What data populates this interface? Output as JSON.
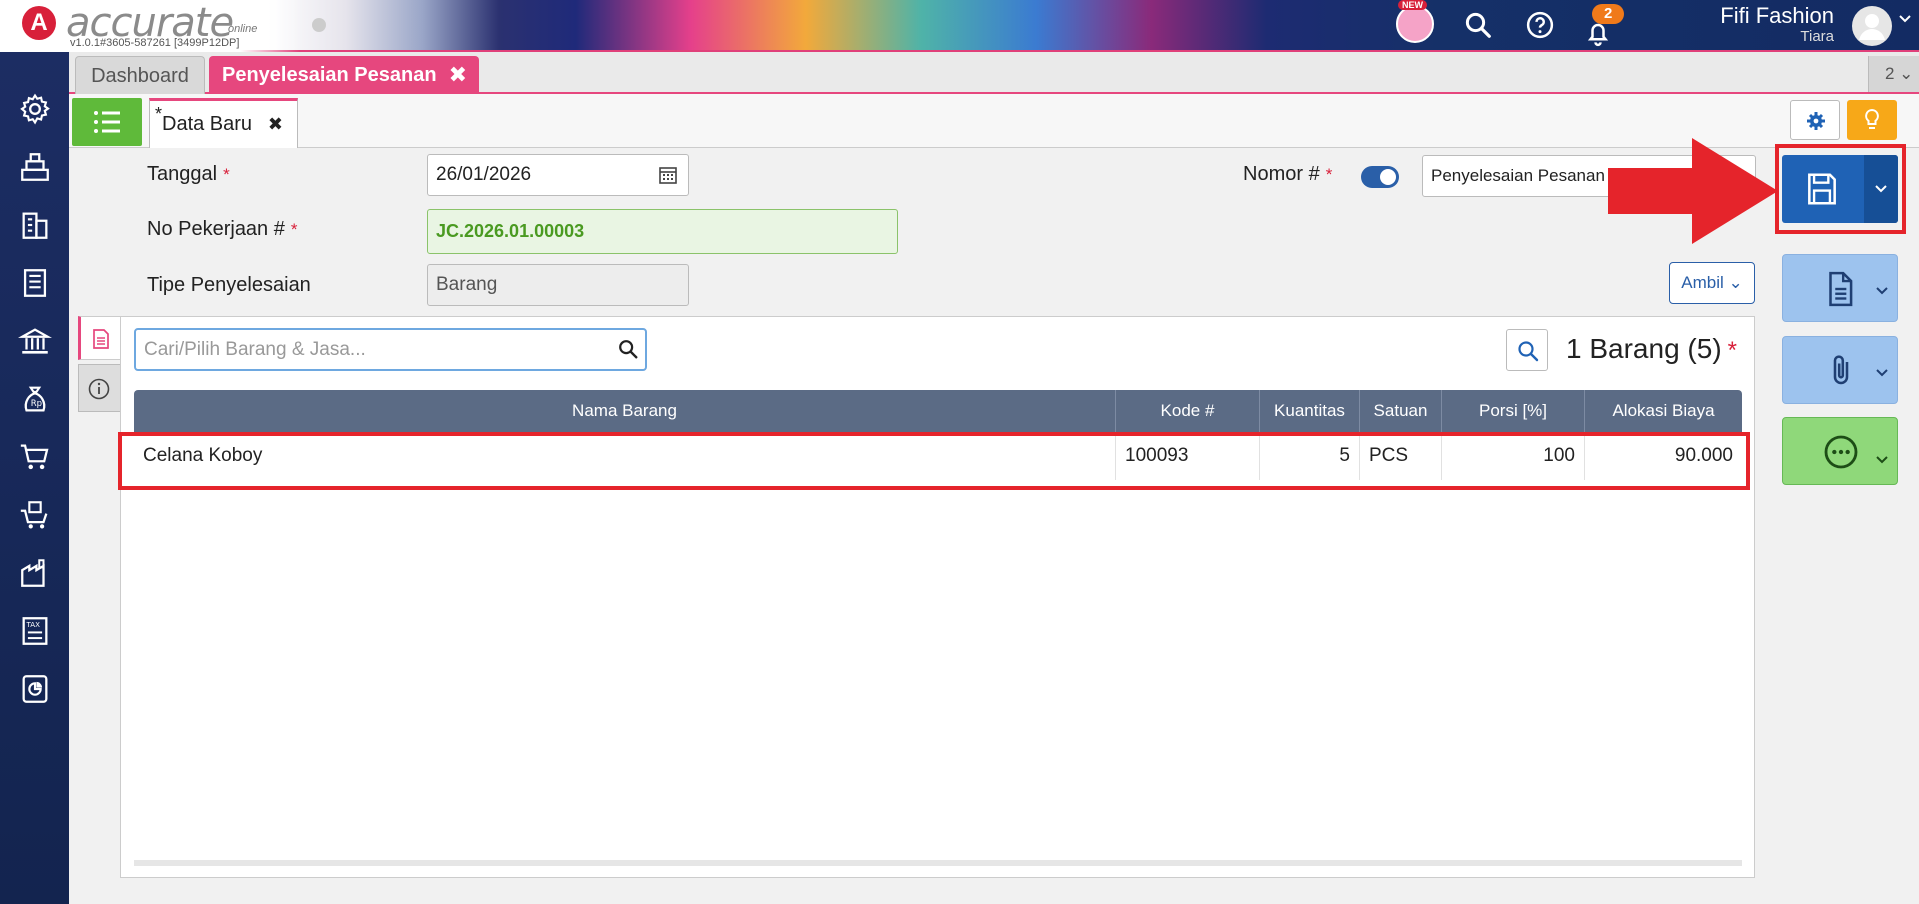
{
  "app": {
    "logo_letter": "A",
    "logo_name": "accurate",
    "logo_sub": "online",
    "version": "v1.0.1#3605-587261 [3499P12DP]",
    "new_badge": "NEW",
    "notification_count": "2",
    "company": "Fifi Fashion",
    "user": "Tiara"
  },
  "tabs": {
    "dashboard": "Dashboard",
    "active": "Penyelesaian Pesanan",
    "close_glyph": "✖",
    "open_count": "2 ⌄"
  },
  "subtab": {
    "label": "Data Baru",
    "star": "*",
    "close_glyph": "✖"
  },
  "form": {
    "tanggal_label": "Tanggal",
    "tanggal_value": "26/01/2026",
    "no_pekerjaan_label": "No Pekerjaan #",
    "no_pekerjaan_value": "JC.2026.01.00003",
    "tipe_label": "Tipe Penyelesaian",
    "tipe_value": "Barang",
    "nomor_label": "Nomor #",
    "nomor_value": "Penyelesaian Pesanan",
    "required_mark": "*",
    "ambil_label": "Ambil ⌄"
  },
  "items": {
    "search_placeholder": "Cari/Pilih Barang & Jasa...",
    "count_label": "1 Barang (5)",
    "columns": [
      "Nama Barang",
      "Kode #",
      "Kuantitas",
      "Satuan",
      "Porsi [%]",
      "Alokasi Biaya"
    ],
    "rows": [
      {
        "nama": "Celana Koboy",
        "kode": "100093",
        "kuantitas": "5",
        "satuan": "PCS",
        "porsi": "100",
        "alokasi": "90.000"
      }
    ]
  },
  "colors": {
    "accent_pink": "#e6477e",
    "save_blue": "#1f62b5",
    "annotation_red": "#e5242b",
    "list_green": "#5fba3a"
  }
}
